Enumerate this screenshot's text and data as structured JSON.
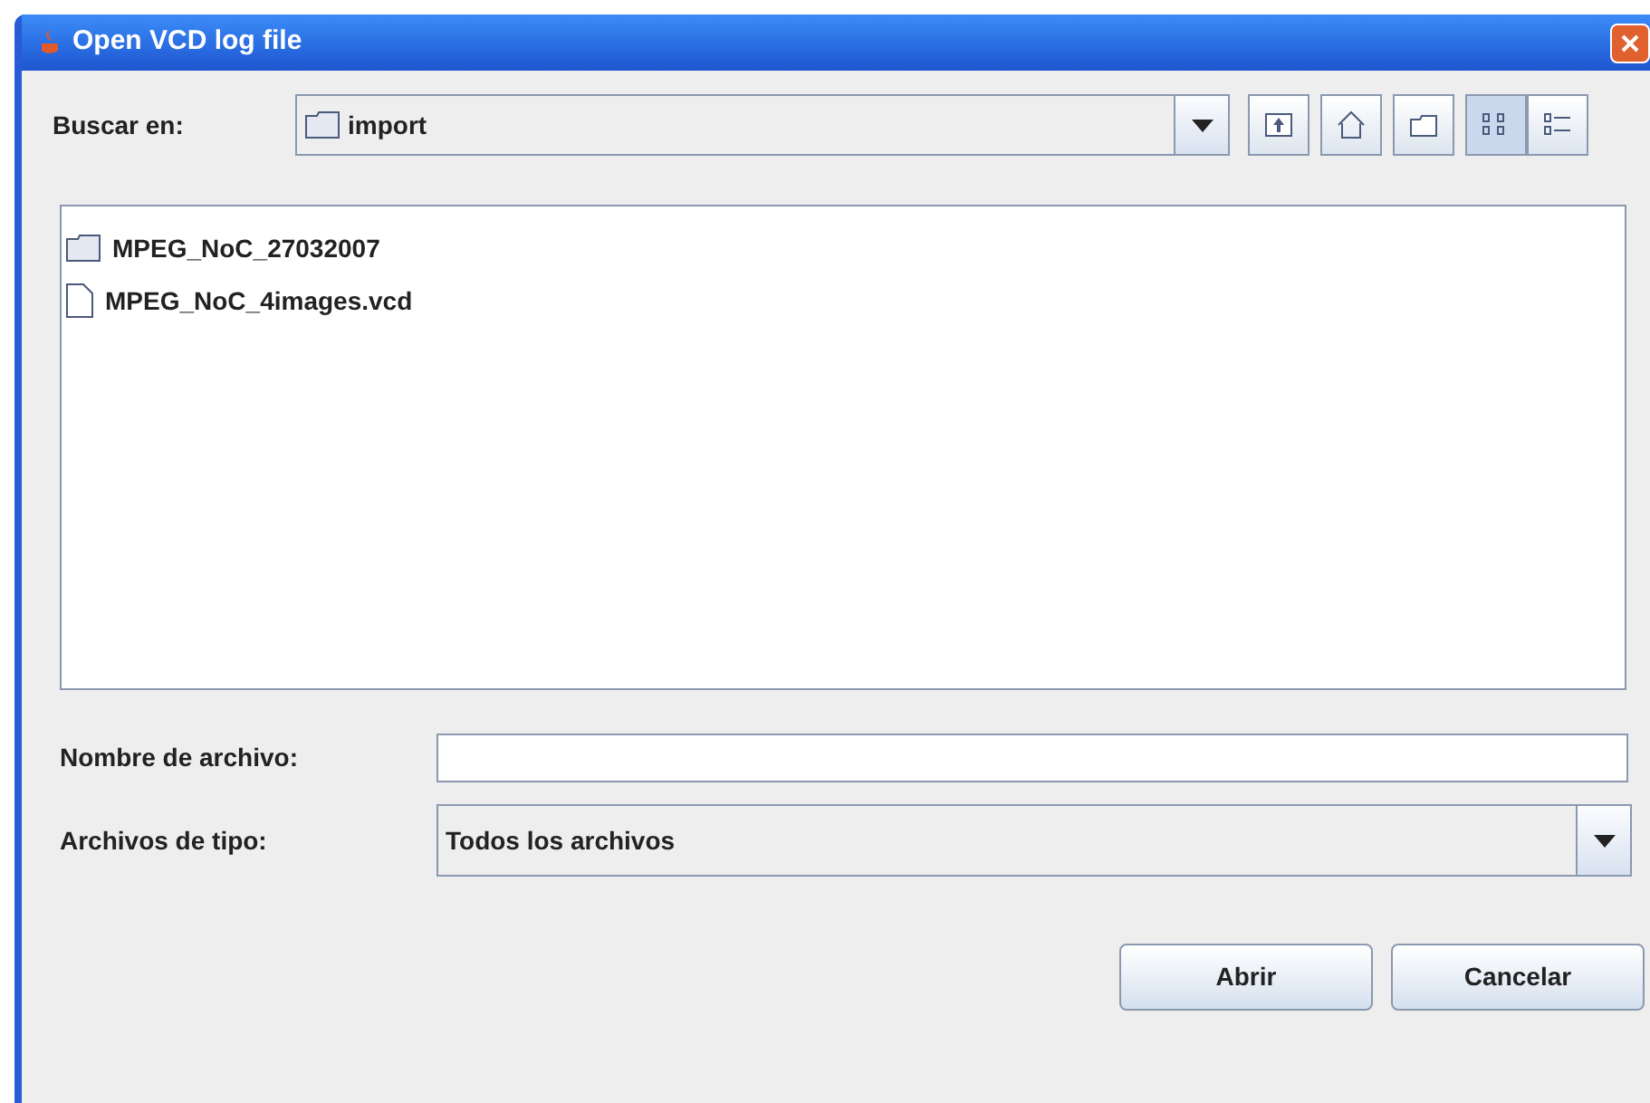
{
  "window": {
    "title": "Open VCD log file"
  },
  "look_in": {
    "label": "Buscar en:",
    "value": "import"
  },
  "toolbar": [
    {
      "kind": "up"
    },
    {
      "kind": "home"
    },
    {
      "kind": "new-folder"
    }
  ],
  "view_buttons": [
    {
      "kind": "list",
      "selected": true
    },
    {
      "kind": "details",
      "selected": false
    }
  ],
  "files": [
    {
      "name": "MPEG_NoC_27032007",
      "kind": "folder"
    },
    {
      "name": "MPEG_NoC_4images.vcd",
      "kind": "file"
    }
  ],
  "file_name": {
    "label": "Nombre de archivo:"
  },
  "file_type": {
    "label": "Archivos de tipo:",
    "value": "Todos los archivos"
  },
  "buttons": [
    "Abrir",
    "Cancelar"
  ]
}
